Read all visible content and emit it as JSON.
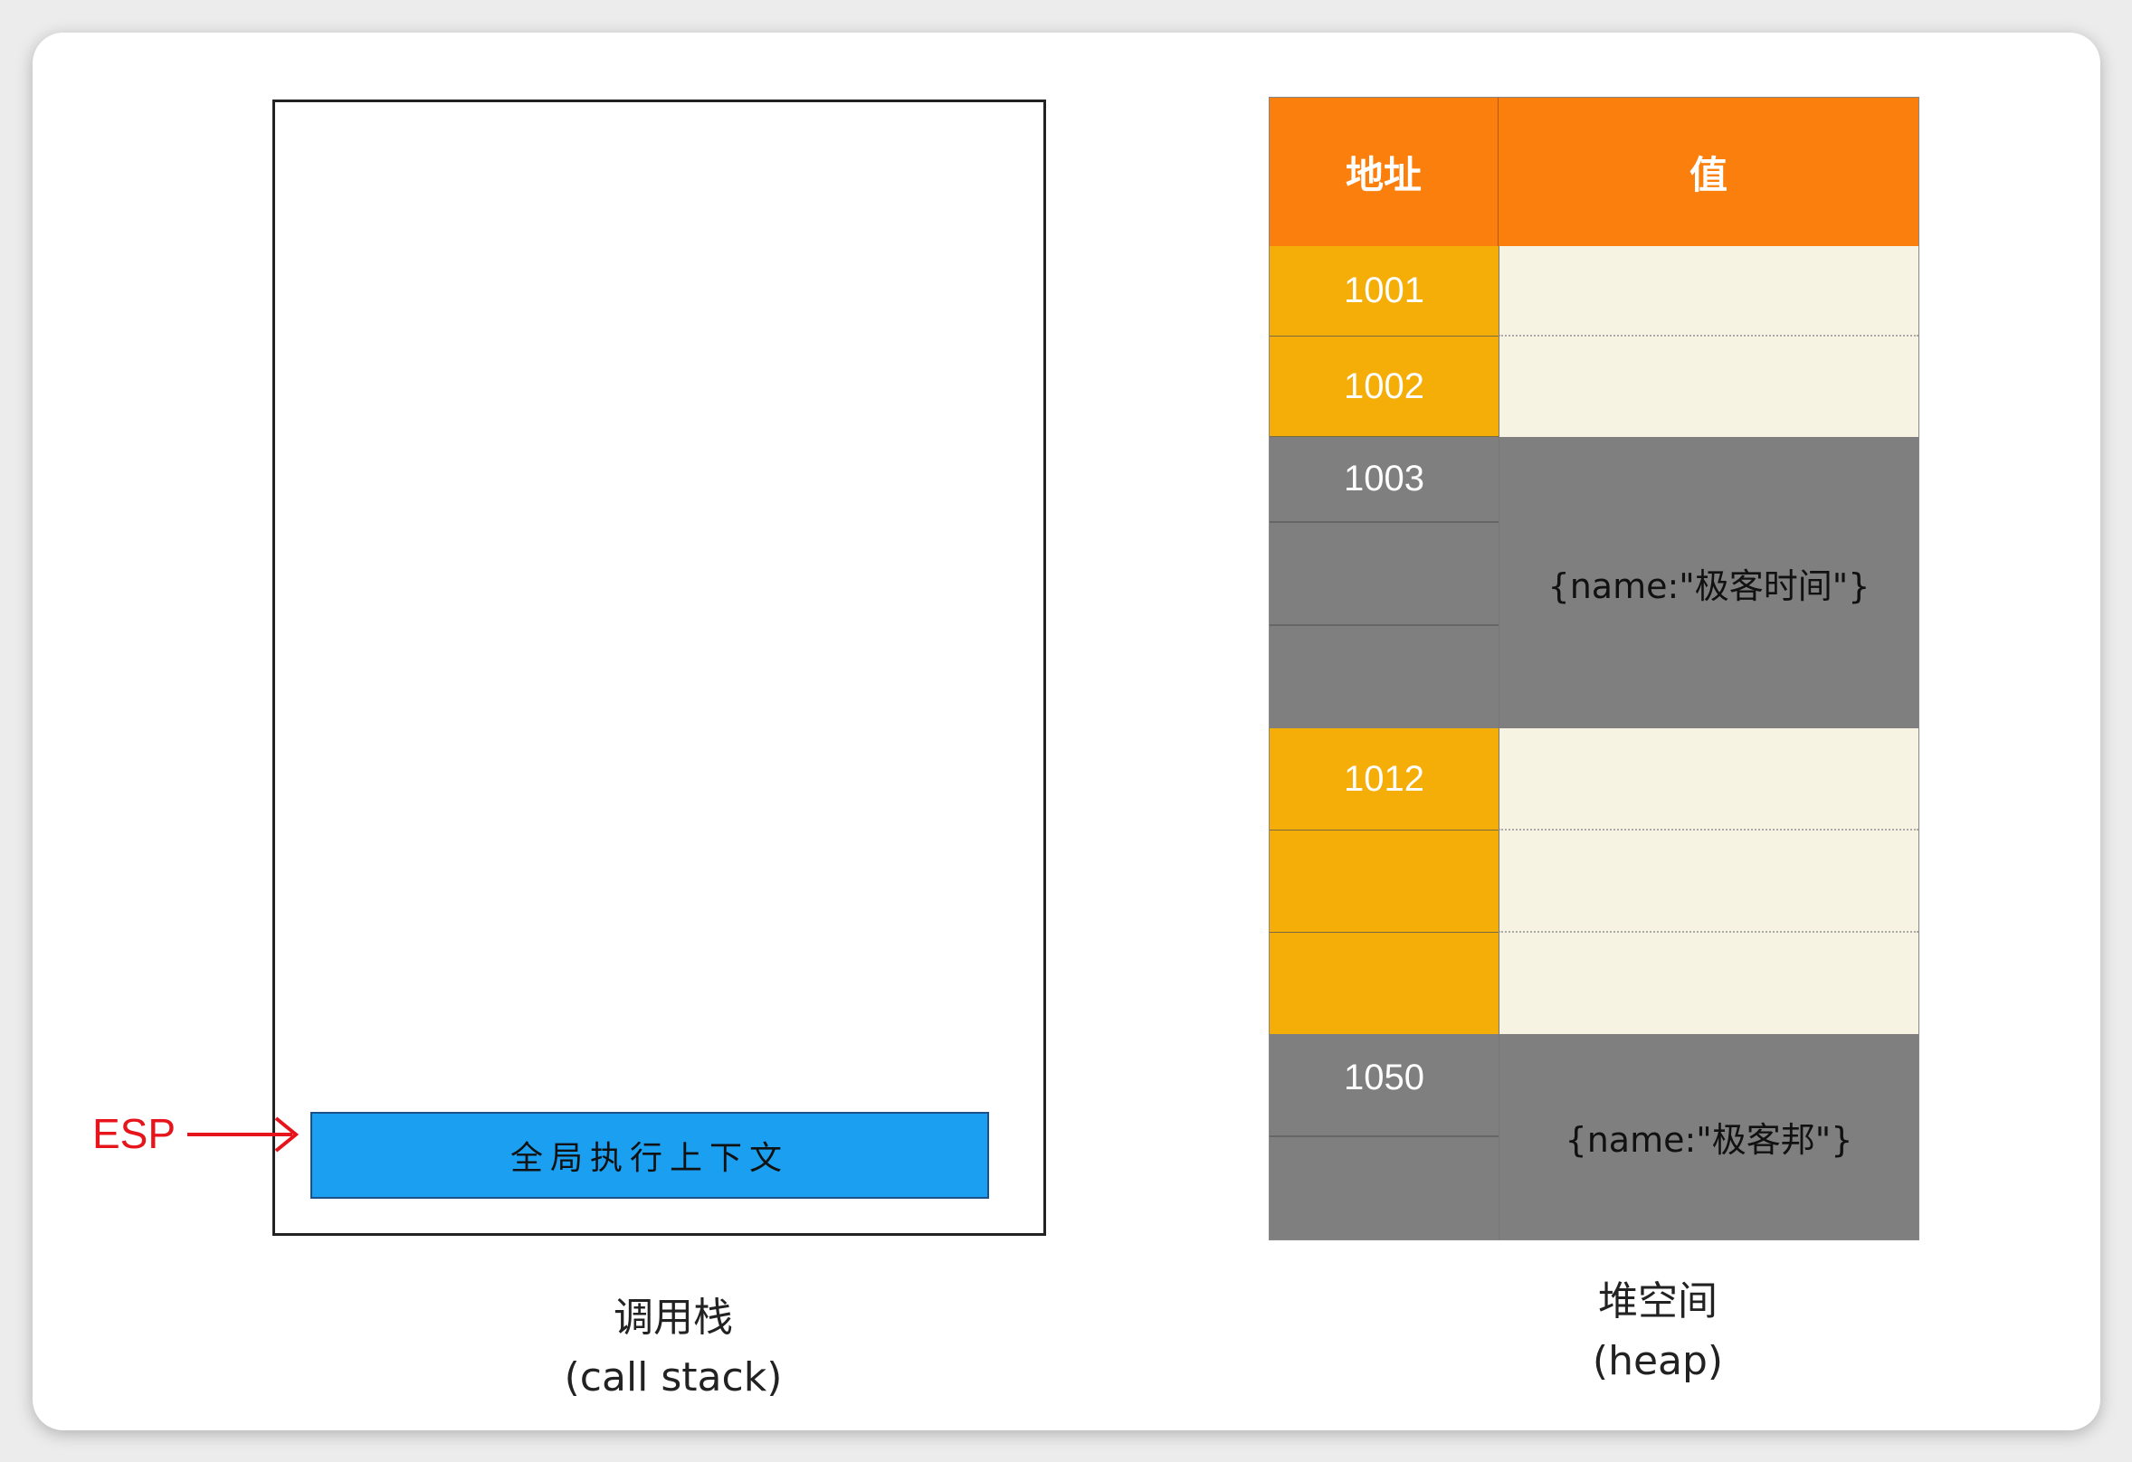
{
  "call_stack": {
    "frames": [
      "全局执行上下文"
    ],
    "pointer_label": "ESP",
    "caption_cn": "调用栈",
    "caption_en": "(call stack)"
  },
  "heap": {
    "headers": {
      "address": "地址",
      "value": "值"
    },
    "addresses": [
      "1001",
      "1002",
      "1003",
      "1012",
      "1050"
    ],
    "objects": [
      "{name:\"极客时间\"}",
      "{name:\"极客邦\"}"
    ],
    "caption_cn": "堆空间",
    "caption_en": "(heap)"
  },
  "colors": {
    "header": "#fa7f0d",
    "address": "#f5ae07",
    "value": "#f7f3e2",
    "object": "#7f7f7f",
    "frame": "#1b9ff0",
    "esp": "#e8141b"
  }
}
